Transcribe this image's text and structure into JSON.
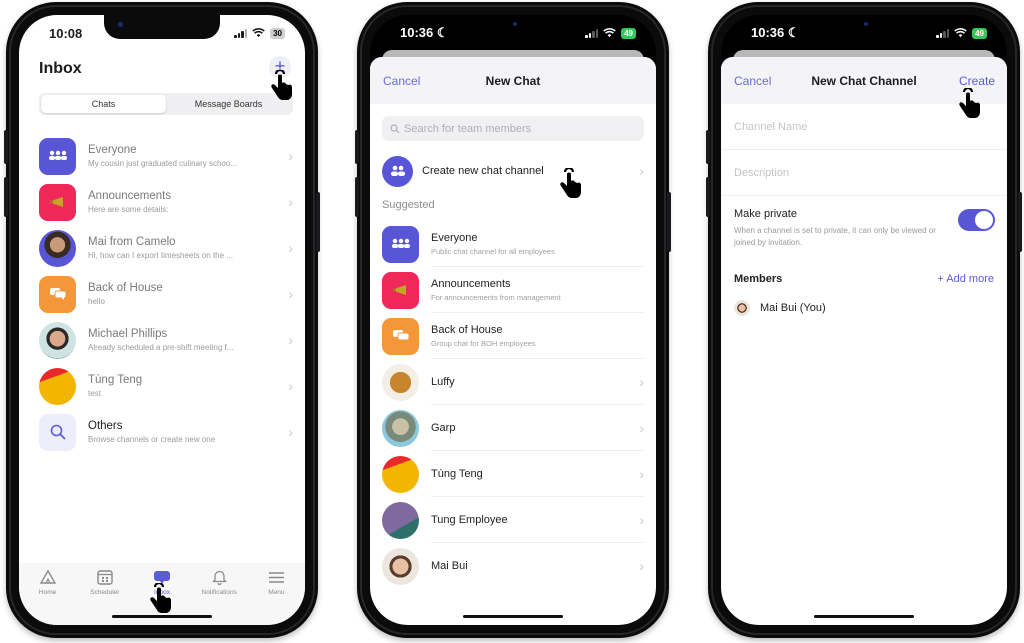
{
  "colors": {
    "accent": "#5b5bd6",
    "everyone": "#5856d6",
    "announcements": "#f0285a",
    "back_of_house": "#f4973a",
    "others": "#eeeefb"
  },
  "phone1": {
    "status": {
      "time": "10:08",
      "battery": "30"
    },
    "title": "Inbox",
    "plus_label": "+",
    "segments": [
      "Chats",
      "Message Boards"
    ],
    "chats": [
      {
        "name": "Everyone",
        "preview": "My cousin just graduated culinary schoo...",
        "icon": "group-icon"
      },
      {
        "name": "Announcements",
        "preview": "Here are some details:",
        "icon": "megaphone-icon"
      },
      {
        "name": "Mai from Camelo",
        "preview": "Hi, how can I export timesheets on the ...",
        "icon": "avatar-photo"
      },
      {
        "name": "Back of House",
        "preview": "hello",
        "icon": "chat-bubbles-icon"
      },
      {
        "name": "Michael Phillips",
        "preview": "Already scheduled a pre-shift meeting f...",
        "icon": "avatar-photo"
      },
      {
        "name": "Tùng Teng",
        "preview": "test",
        "icon": "avatar-abstract"
      },
      {
        "name": "Others",
        "preview": "Browse channels or create new one",
        "icon": "search-icon"
      }
    ],
    "tabs": [
      "Home",
      "Scheduler",
      "Inbox",
      "Notifications",
      "Menu"
    ]
  },
  "phone2": {
    "status": {
      "time": "10:36",
      "battery": "49"
    },
    "cancel": "Cancel",
    "title": "New Chat",
    "search_placeholder": "Search for team members",
    "create_channel": "Create new chat channel",
    "section": "Suggested",
    "suggested": [
      {
        "name": "Everyone",
        "sub": "Public chat channel for all employees"
      },
      {
        "name": "Announcements",
        "sub": "For announcements from management"
      },
      {
        "name": "Back of House",
        "sub": "Group chat for BOH employees"
      },
      {
        "name": "Luffy",
        "sub": ""
      },
      {
        "name": "Garp",
        "sub": ""
      },
      {
        "name": "Tùng Teng",
        "sub": ""
      },
      {
        "name": "Tung Employee",
        "sub": ""
      },
      {
        "name": "Mai Bui",
        "sub": ""
      }
    ]
  },
  "phone3": {
    "status": {
      "time": "10:36",
      "battery": "49"
    },
    "cancel": "Cancel",
    "title": "New Chat Channel",
    "create": "Create",
    "channel_name_placeholder": "Channel Name",
    "description_placeholder": "Description",
    "make_private": "Make private",
    "make_private_on": true,
    "private_desc": "When a channel is set to private, it can only be viewed or joined by invitation.",
    "members_title": "Members",
    "add_more": "+ Add more",
    "member": "Mai Bui (You)"
  }
}
